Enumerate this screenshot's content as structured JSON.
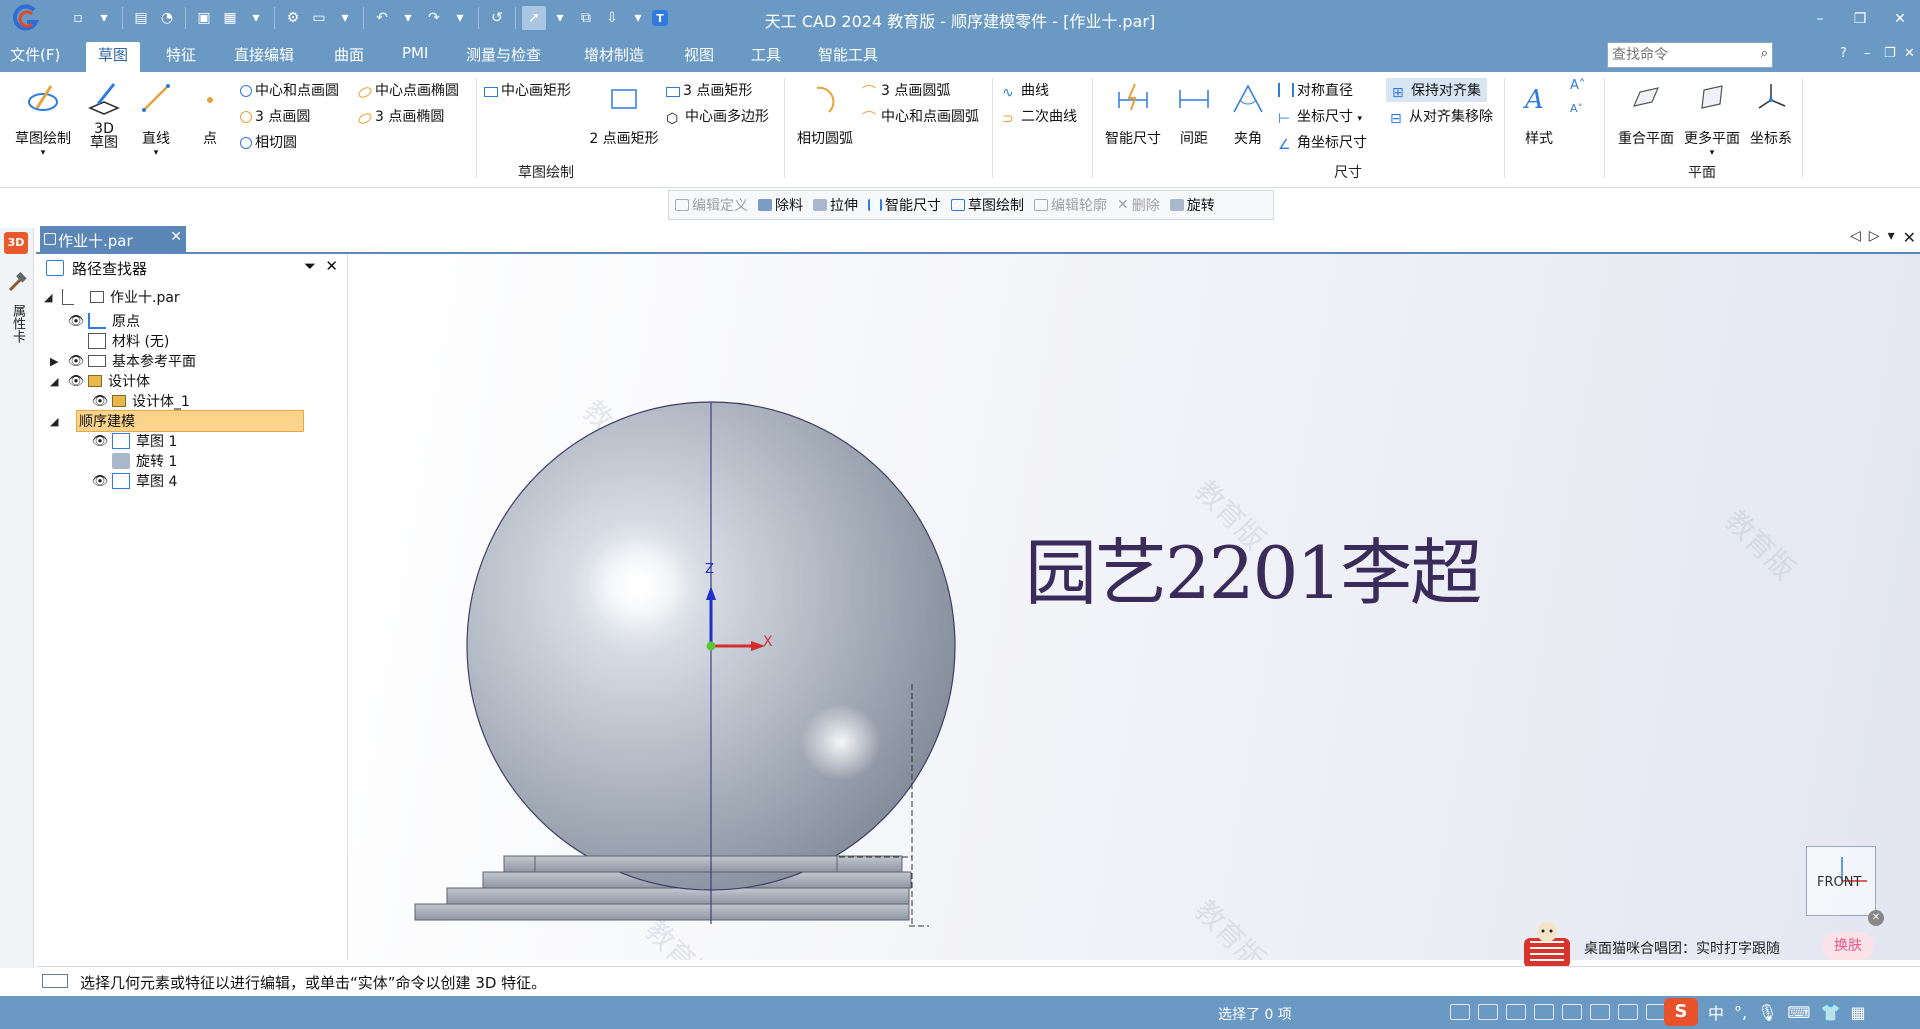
{
  "app": {
    "title": "天工 CAD 2024 教育版 - 顺序建模零件 - [作业十.par]"
  },
  "window_controls": {
    "minimize": "–",
    "restore": "❐",
    "close": "✕"
  },
  "menu": {
    "items": [
      "文件(F)",
      "草图",
      "特征",
      "直接编辑",
      "曲面",
      "PMI",
      "测量与检查",
      "增材制造",
      "视图",
      "工具",
      "智能工具"
    ],
    "active": "草图",
    "search_placeholder": "查找命令",
    "help": "?"
  },
  "ribbon": {
    "sketch_draw": "草图绘制",
    "sketch_3d": "3D\n草图",
    "line": "直线",
    "point": "点",
    "center_point_circle": "中心和点画圆",
    "three_point_circle": "3 点画圆",
    "tangent_circle": "相切圆",
    "center_point_ellipse": "中心点画椭圆",
    "three_point_ellipse": "3 点画椭圆",
    "center_rect": "中心画矩形",
    "two_point_rect": "2 点画矩形",
    "three_point_rect": "3 点画矩形",
    "center_polygon": "中心画多边形",
    "tangent_arc": "相切圆弧",
    "three_point_arc": "3 点画圆弧",
    "center_point_arc": "中心和点画圆弧",
    "curve": "曲线",
    "conic": "二次曲线",
    "group_sketch": "草图绘制",
    "smart_dimension": "智能尺寸",
    "distance": "间距",
    "angle": "夹角",
    "symmetric_diameter": "对称直径",
    "coordinate_dim": "坐标尺寸",
    "angle_coordinate_dim": "角坐标尺寸",
    "keep_align": "保持对齐集",
    "remove_align": "从对齐集移除",
    "group_dimension": "尺寸",
    "style": "样式",
    "coincident_plane": "重合平面",
    "more_planes": "更多平面",
    "coordinate_system": "坐标系",
    "group_plane": "平面"
  },
  "command_bar": {
    "edit_definition": "编辑定义",
    "remove_material": "除料",
    "extrude": "拉伸",
    "smart_dimension": "智能尺寸",
    "sketch_draw": "草图绘制",
    "edit_profile": "编辑轮廓",
    "delete": "删除",
    "revolve": "旋转"
  },
  "side_strip": {
    "badge": "3D",
    "label": "属性卡"
  },
  "doc_tab": {
    "label": "作业十.par"
  },
  "pathfinder": {
    "title": "路径查找器",
    "items": [
      {
        "label": "作业十.par"
      },
      {
        "label": "原点"
      },
      {
        "label": "材料 (无)"
      },
      {
        "label": "基本参考平面"
      },
      {
        "label": "设计体"
      },
      {
        "label": "设计体_1"
      },
      {
        "label": "顺序建模"
      },
      {
        "label": "草图 1"
      },
      {
        "label": "旋转 1"
      },
      {
        "label": "草图 4"
      }
    ]
  },
  "viewport": {
    "watermark": "教育版",
    "annotation": "园艺2201李超",
    "axis_x": "X",
    "axis_z": "Z",
    "view_label": "FRONT"
  },
  "prompt": {
    "text": "选择几何元素或特征以进行编辑，或单击“实体”命令以创建 3D 特征。"
  },
  "status": {
    "selected": "选择了 0 项"
  },
  "tray": {
    "ime_logo": "S",
    "ime_mode": "中",
    "punct": "°,"
  },
  "notification": {
    "text": "桌面猫咪合唱团：实时打字跟随",
    "button": "换肤",
    "close": "✕"
  },
  "colors": {
    "title_bar": "#6a9ac4",
    "active_tab": "#2f64a3",
    "highlight": "#fbd38a",
    "axis_x": "#d62c2c",
    "axis_z": "#2030c8"
  }
}
